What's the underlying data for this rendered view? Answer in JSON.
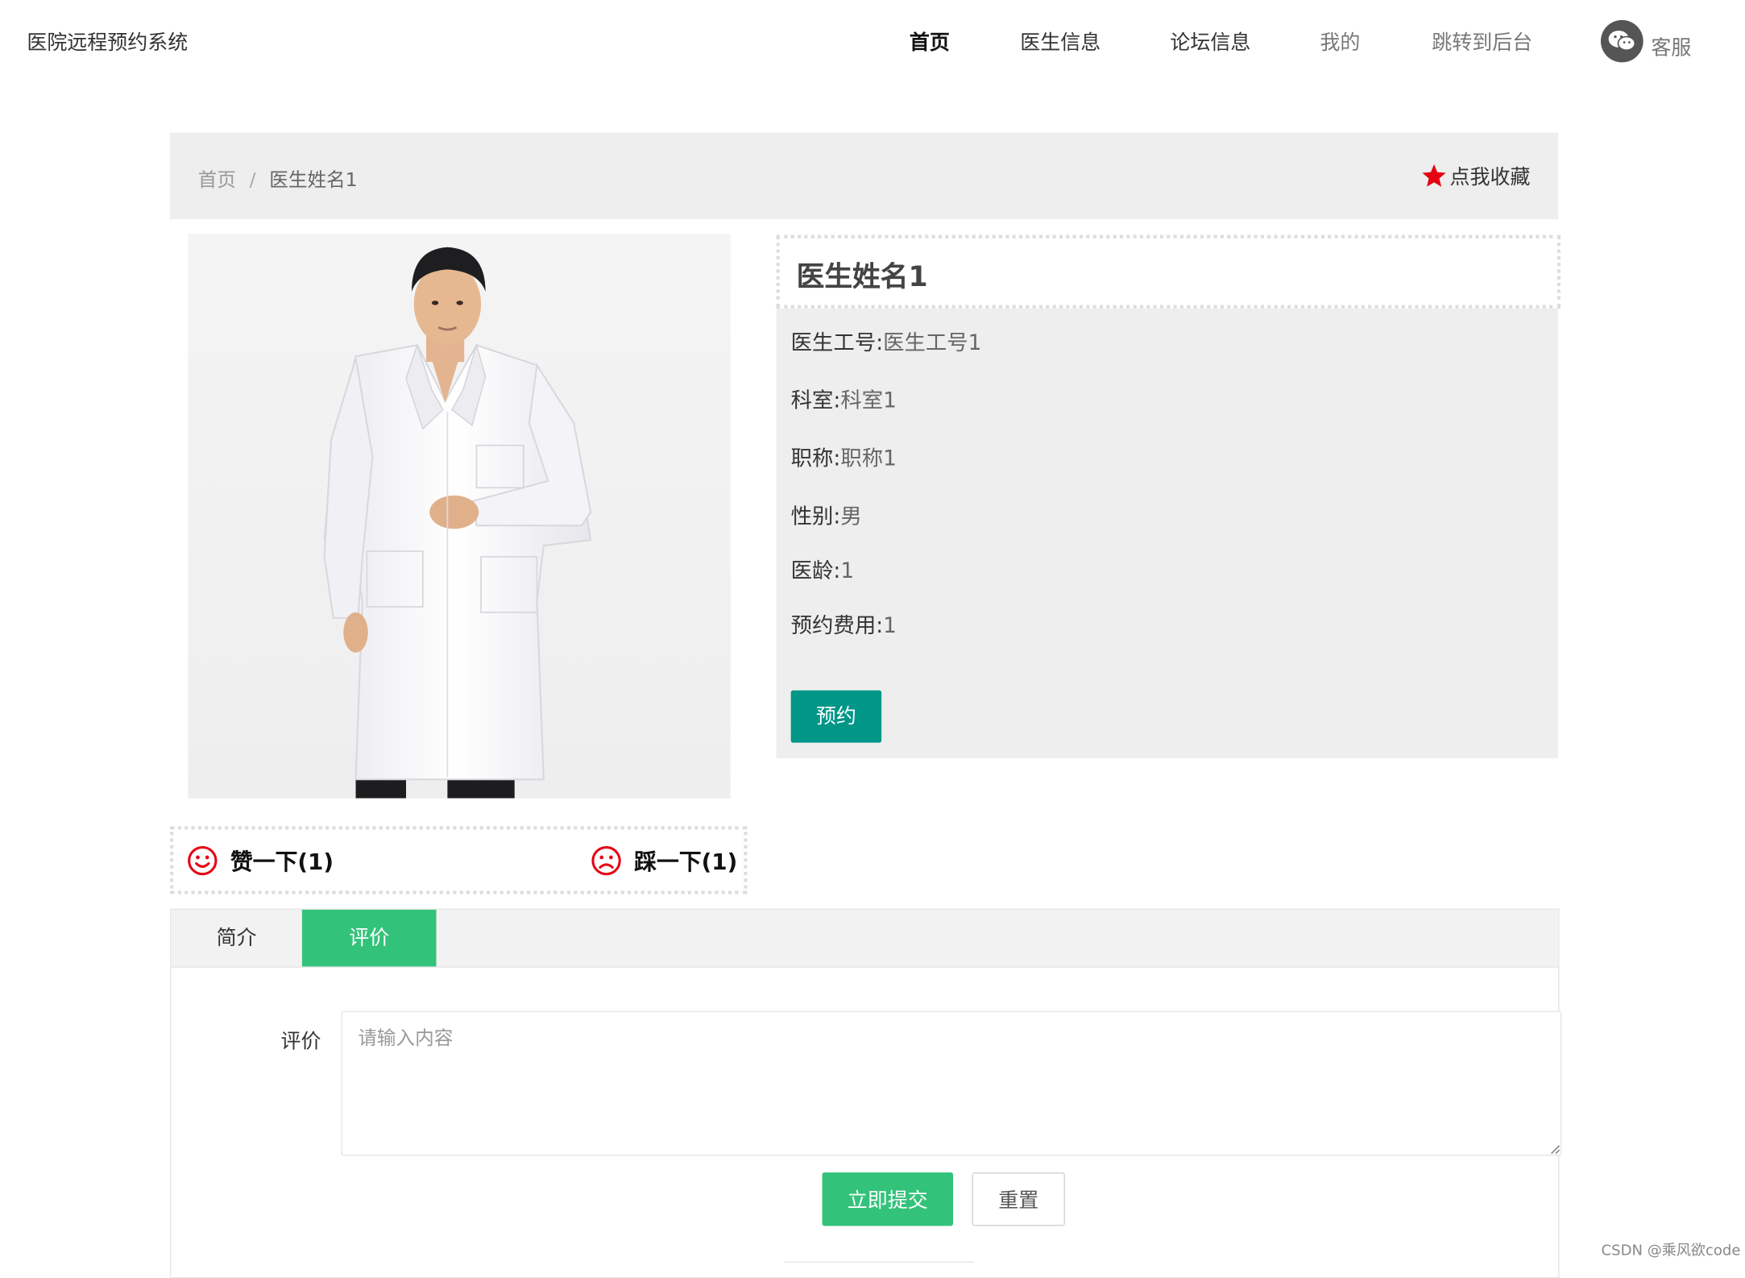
{
  "header": {
    "site_title": "医院远程预约系统",
    "nav": [
      {
        "label": "首页"
      },
      {
        "label": "医生信息"
      },
      {
        "label": "论坛信息"
      },
      {
        "label": "我的"
      },
      {
        "label": "跳转到后台"
      }
    ],
    "service": {
      "label": "客服",
      "icon": "wechat-icon"
    }
  },
  "breadcrumb": {
    "home": "首页",
    "separator": "/",
    "current": "医生姓名1"
  },
  "favorite": {
    "label": "点我收藏",
    "icon": "star-icon",
    "color": "#e60012"
  },
  "doctor": {
    "photo": "doctor-photo",
    "name": "医生姓名1",
    "fields": [
      {
        "label": "医生工号:",
        "value": "医生工号1"
      },
      {
        "label": "科室:",
        "value": "科室1"
      },
      {
        "label": "职称:",
        "value": "职称1"
      },
      {
        "label": "性别:",
        "value": "男"
      },
      {
        "label": "医龄:",
        "value": "1"
      },
      {
        "label": "预约费用:",
        "value": "1"
      }
    ],
    "reserve_button": "预约"
  },
  "votes": {
    "like": {
      "label": "赞一下(1)",
      "icon": "smile-icon"
    },
    "dislike": {
      "label": "踩一下(1)",
      "icon": "frown-icon"
    },
    "icon_color": "#e60012"
  },
  "tabs": [
    {
      "label": "简介",
      "active": false
    },
    {
      "label": "评价",
      "active": true
    }
  ],
  "comment_form": {
    "label": "评价",
    "placeholder": "请输入内容",
    "value": "",
    "submit": "立即提交",
    "reset": "重置"
  },
  "colors": {
    "primary_teal": "#009688",
    "accent_green": "#33c27a",
    "panel_gray": "#eeeeee"
  },
  "watermark": "CSDN @乘风欲code"
}
